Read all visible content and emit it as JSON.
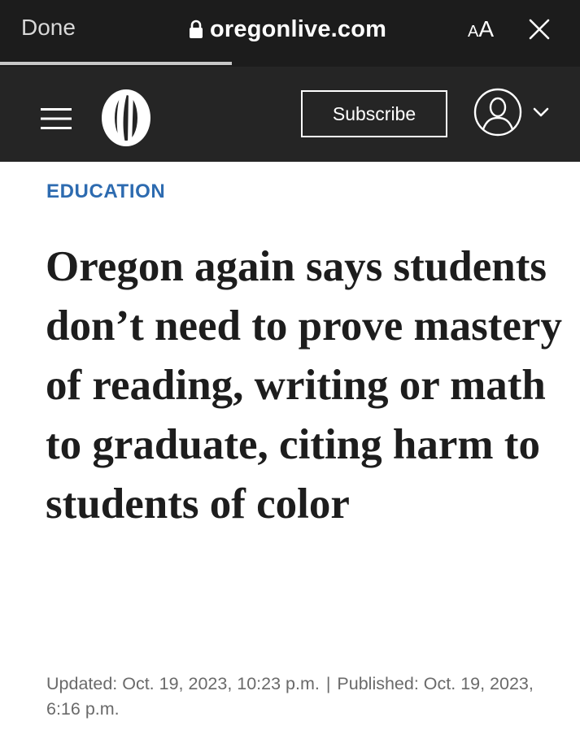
{
  "browser": {
    "done_label": "Done",
    "url": "oregonlive.com",
    "text_size_label_small": "A",
    "text_size_label_big": "A",
    "load_progress": 0.4
  },
  "header": {
    "logo_icon": "oregonian-o-logo-icon",
    "menu_icon": "hamburger-menu-icon",
    "subscribe_label": "Subscribe",
    "account_icon": "user-account-icon",
    "colors": {
      "background": "#252525",
      "foreground": "#ffffff"
    }
  },
  "article": {
    "section": "EDUCATION",
    "section_color": "#2d6bb0",
    "headline": "Oregon again says students don’t need to prove mastery of reading, writing or math to graduate, citing harm to students of color",
    "updated": "Updated: Oct. 19, 2023, 10:23 p.m.",
    "separator": "|",
    "published": "Published: Oct. 19, 2023, 6:16 p.m."
  }
}
